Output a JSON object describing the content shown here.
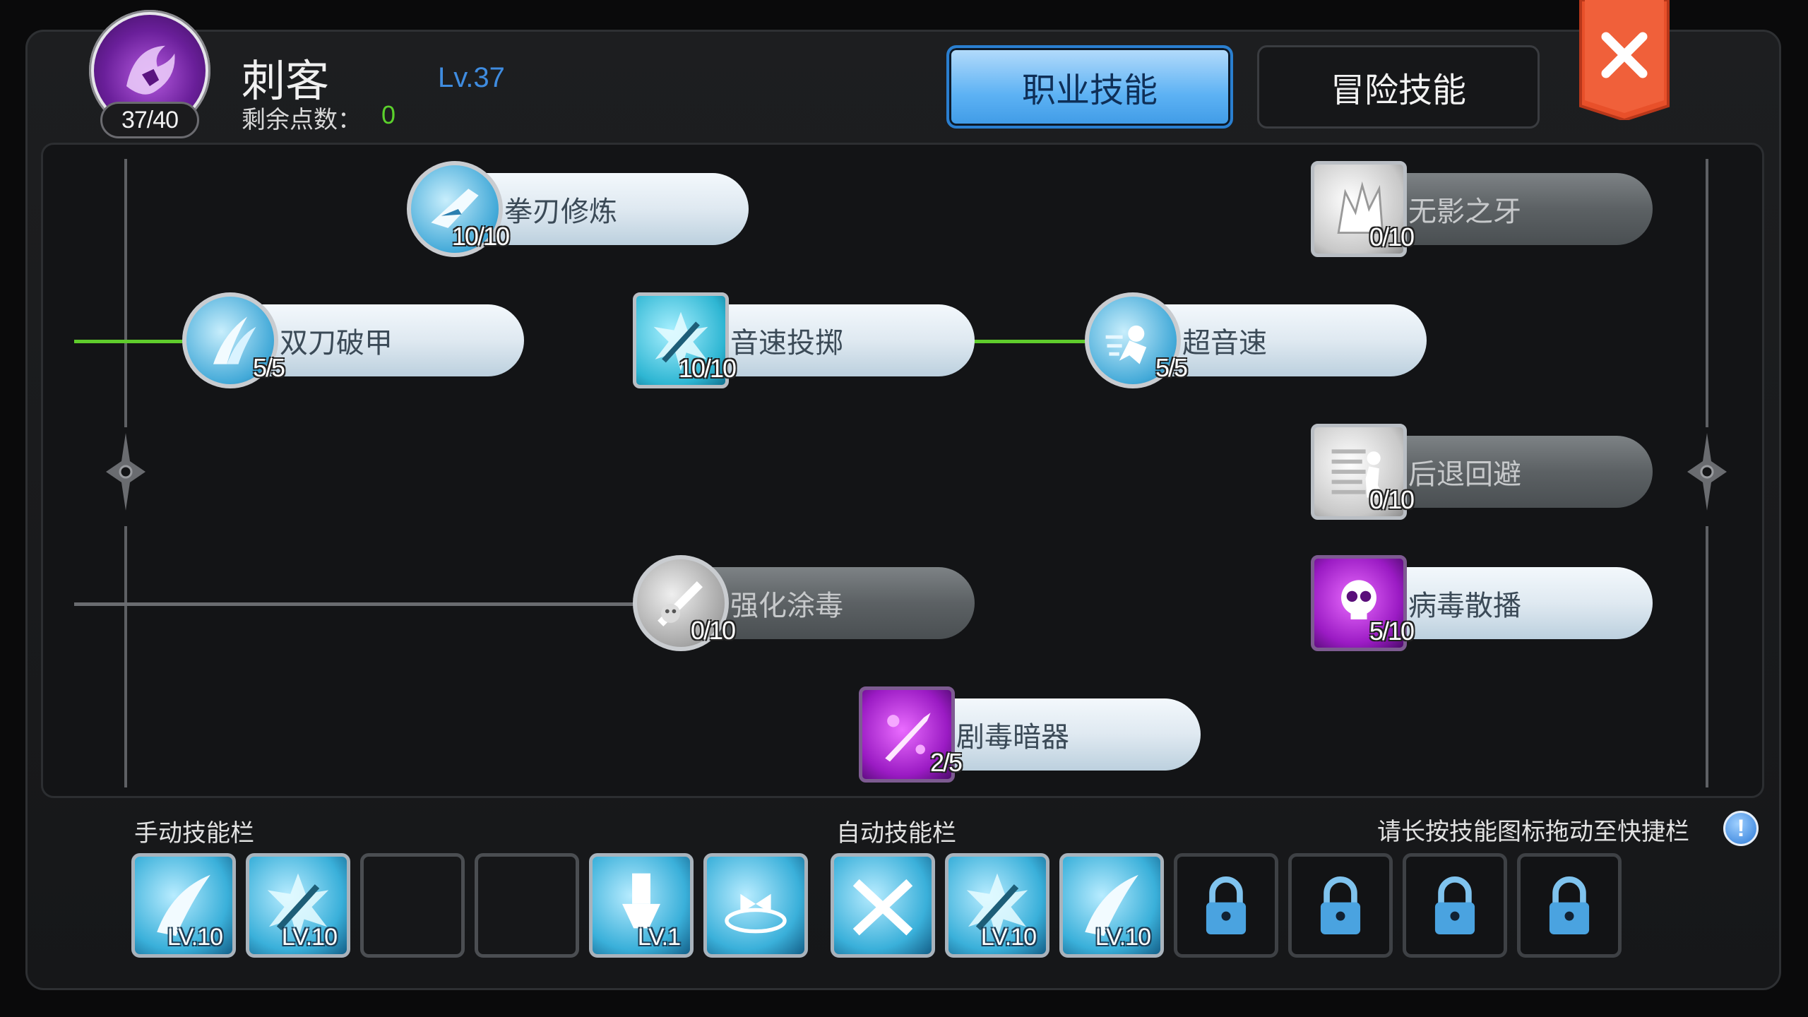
{
  "header": {
    "job_name": "刺客",
    "level": "Lv.37",
    "points": "37/40",
    "remaining_label": "剩余点数：",
    "remaining_value": "0"
  },
  "tabs": [
    {
      "label": "职业技能",
      "active": true
    },
    {
      "label": "冒险技能",
      "active": false
    }
  ],
  "colors": {
    "accent_blue": "#3f9be6",
    "learned_green": "#5fcc2c",
    "close_red": "#e8502a"
  },
  "skills": [
    {
      "name": "拳刃修炼",
      "level": "10/10",
      "icon": "fist-blade-icon",
      "learned": true
    },
    {
      "name": "无影之牙",
      "level": "0/10",
      "icon": "shadow-fang-icon",
      "learned": false
    },
    {
      "name": "双刀破甲",
      "level": "5/5",
      "icon": "dual-blade-icon",
      "learned": true
    },
    {
      "name": "音速投掷",
      "level": "10/10",
      "icon": "sonic-throw-icon",
      "learned": true
    },
    {
      "name": "超音速",
      "level": "5/5",
      "icon": "supersonic-icon",
      "learned": true
    },
    {
      "name": "后退回避",
      "level": "0/10",
      "icon": "backstep-icon",
      "learned": false
    },
    {
      "name": "强化涂毒",
      "level": "0/10",
      "icon": "enchant-poison-icon",
      "learned": false
    },
    {
      "name": "病毒散播",
      "level": "5/10",
      "icon": "virus-spread-icon",
      "learned": true
    },
    {
      "name": "剧毒暗器",
      "level": "2/5",
      "icon": "poison-dagger-icon",
      "learned": true
    }
  ],
  "bars": {
    "manual_label": "手动技能栏",
    "auto_label": "自动技能栏",
    "hint": "请长按技能图标拖动至快捷栏",
    "hint_icon": "info-icon",
    "manual_slots": [
      {
        "icon": "slash-icon",
        "level": "LV.10"
      },
      {
        "icon": "sonic-throw-icon",
        "level": "LV.10"
      },
      {
        "icon": "",
        "level": ""
      },
      {
        "icon": "",
        "level": ""
      },
      {
        "icon": "potion-icon",
        "level": "LV.1"
      },
      {
        "icon": "bow-burst-icon",
        "level": ""
      }
    ],
    "auto_slots": [
      {
        "icon": "cross-blade-icon",
        "level": ""
      },
      {
        "icon": "sonic-throw-icon",
        "level": "LV.10"
      },
      {
        "icon": "slash-icon",
        "level": "LV.10"
      },
      {
        "icon": "lock-icon",
        "level": ""
      },
      {
        "icon": "lock-icon",
        "level": ""
      },
      {
        "icon": "lock-icon",
        "level": ""
      },
      {
        "icon": "lock-icon",
        "level": ""
      }
    ]
  }
}
